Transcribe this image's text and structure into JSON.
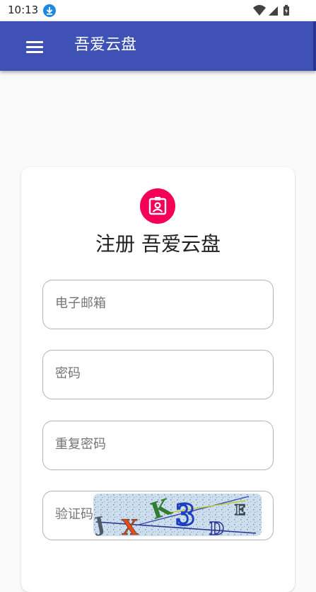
{
  "status_bar": {
    "time": "10:13",
    "download_icon": "download-icon",
    "wifi_icon": "wifi-icon",
    "signal_icon": "cell-signal-icon",
    "battery_icon": "battery-icon"
  },
  "app_bar": {
    "menu_icon": "menu-icon",
    "title": "吾爱云盘",
    "color": "#3f51b5"
  },
  "register": {
    "avatar_icon": "contact-badge-icon",
    "avatar_color": "#f50057",
    "title": "注册 吾爱云盘",
    "email_placeholder": "电子邮箱",
    "password_placeholder": "密码",
    "repeat_password_placeholder": "重复密码",
    "captcha_placeholder": "验证码",
    "captcha_text": "JXK3DE"
  }
}
